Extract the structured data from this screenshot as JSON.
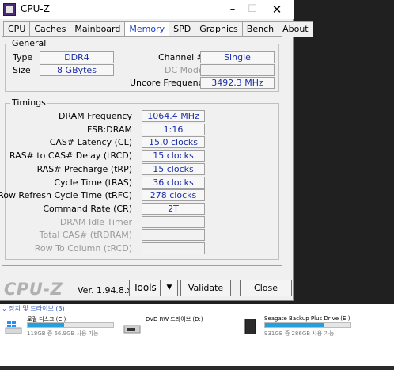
{
  "window": {
    "title": "CPU-Z",
    "min_glyph": "–",
    "max_glyph": "☐",
    "close_glyph": "✕"
  },
  "tabs": [
    "CPU",
    "Caches",
    "Mainboard",
    "Memory",
    "SPD",
    "Graphics",
    "Bench",
    "About"
  ],
  "active_tab": "Memory",
  "general": {
    "label": "General",
    "type_label": "Type",
    "type_value": "DDR4",
    "size_label": "Size",
    "size_value": "8 GBytes",
    "channel_label": "Channel #",
    "channel_value": "Single",
    "dcmode_label": "DC Mode",
    "dcmode_value": "",
    "uncore_label": "Uncore Frequency",
    "uncore_value": "3492.3 MHz"
  },
  "timings": {
    "label": "Timings",
    "rows": [
      {
        "label": "DRAM Frequency",
        "value": "1064.4 MHz",
        "dim": false
      },
      {
        "label": "FSB:DRAM",
        "value": "1:16",
        "dim": false
      },
      {
        "label": "CAS# Latency (CL)",
        "value": "15.0 clocks",
        "dim": false
      },
      {
        "label": "RAS# to CAS# Delay (tRCD)",
        "value": "15 clocks",
        "dim": false
      },
      {
        "label": "RAS# Precharge (tRP)",
        "value": "15 clocks",
        "dim": false
      },
      {
        "label": "Cycle Time (tRAS)",
        "value": "36 clocks",
        "dim": false
      },
      {
        "label": "Row Refresh Cycle Time (tRFC)",
        "value": "278 clocks",
        "dim": false
      },
      {
        "label": "Command Rate (CR)",
        "value": "2T",
        "dim": false
      },
      {
        "label": "DRAM Idle Timer",
        "value": "",
        "dim": true
      },
      {
        "label": "Total CAS# (tRDRAM)",
        "value": "",
        "dim": true
      },
      {
        "label": "Row To Column (tRCD)",
        "value": "",
        "dim": true
      }
    ]
  },
  "footer": {
    "brand": "CPU-Z",
    "version": "Ver. 1.94.8.x64",
    "tools_label": "Tools",
    "tools_dropdown": "▼",
    "validate_label": "Validate",
    "close_label": "Close"
  },
  "explorer": {
    "header": "⌄ 장치 및 드라이브 (3)",
    "drives": [
      {
        "name": "로컬 디스크 (C:)",
        "info": "118GB 중 66.9GB 사용 가능",
        "used_fraction": 0.43,
        "icon": "windows-drive-icon"
      },
      {
        "name": "DVD RW 드라이브 (D:)",
        "info": "",
        "used_fraction": null,
        "icon": "dvd-drive-icon"
      },
      {
        "name": "Seagate Backup Plus Drive (E:)",
        "info": "931GB 중 286GB 사용 가능",
        "used_fraction": 0.69,
        "icon": "external-drive-icon"
      }
    ]
  },
  "colors": {
    "value_text": "#1c2ea8",
    "active_tab": "#1a3cc7",
    "drive_bar": "#26a0da"
  }
}
